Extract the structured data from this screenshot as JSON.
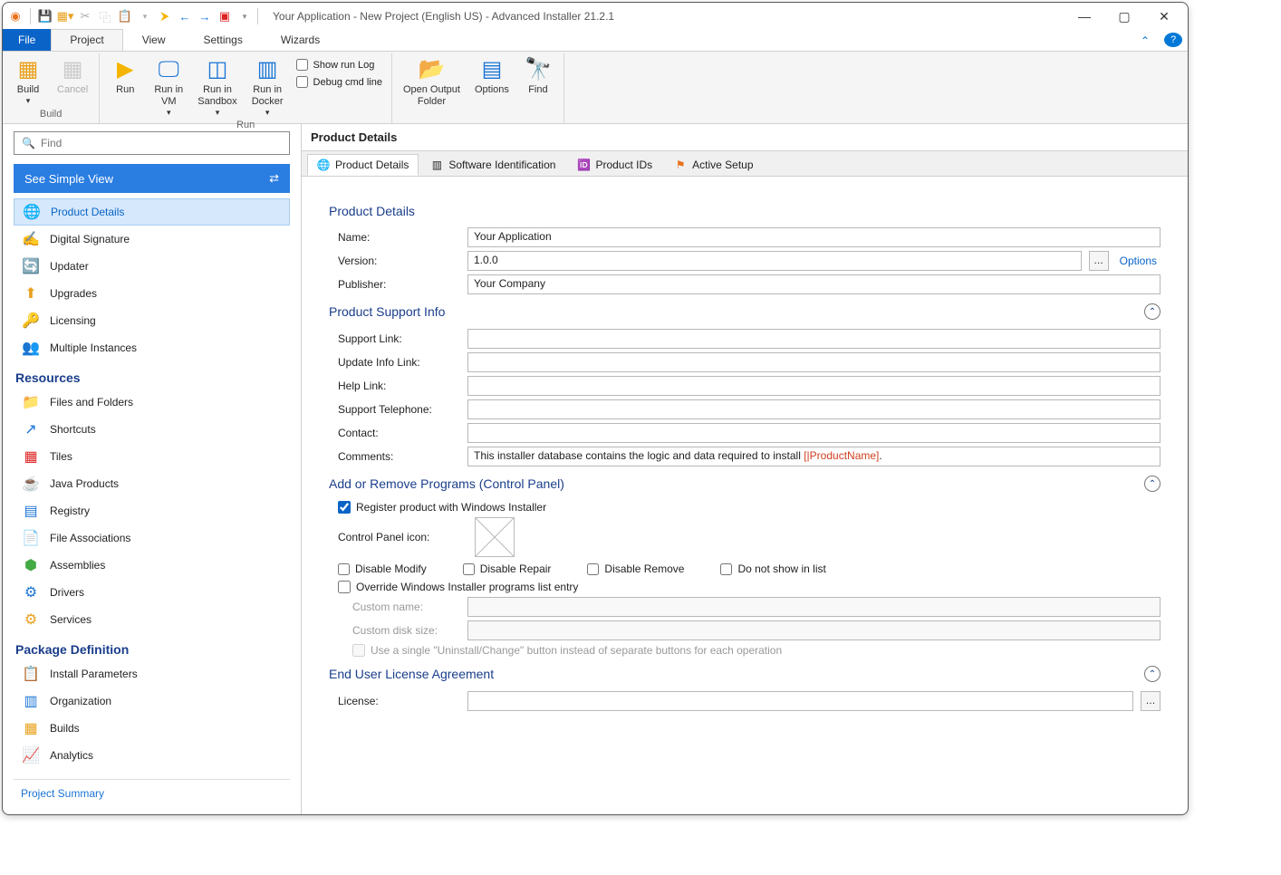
{
  "window": {
    "title": "Your Application - New Project (English US) - Advanced Installer 21.2.1"
  },
  "qat": {
    "icons": [
      "app-icon",
      "save-icon",
      "package-icon",
      "scissors-icon",
      "copy-icon",
      "paste-icon",
      "undo-icon",
      "forward-arrow-icon",
      "back-icon",
      "forward-icon",
      "ext-icon",
      "dropdown-icon"
    ]
  },
  "ribbon_tabs": {
    "file": "File",
    "items": [
      "Project",
      "View",
      "Settings",
      "Wizards"
    ]
  },
  "ribbon": {
    "build": {
      "build": "Build",
      "cancel": "Cancel",
      "label": "Build"
    },
    "run": {
      "run": "Run",
      "vm": "Run in\nVM",
      "sandbox": "Run in\nSandbox",
      "docker": "Run in\nDocker",
      "show_log": "Show run Log",
      "debug": "Debug cmd line",
      "open_output": "Open Output\nFolder",
      "options": "Options",
      "find": "Find",
      "label": "Run"
    }
  },
  "sidebar": {
    "search_placeholder": "Find",
    "simple_view": "See Simple View",
    "groups": [
      {
        "title": "",
        "items": [
          "Product Details",
          "Digital Signature",
          "Updater",
          "Upgrades",
          "Licensing",
          "Multiple Instances"
        ]
      },
      {
        "title": "Resources",
        "items": [
          "Files and Folders",
          "Shortcuts",
          "Tiles",
          "Java Products",
          "Registry",
          "File Associations",
          "Assemblies",
          "Drivers",
          "Services"
        ]
      },
      {
        "title": "Package Definition",
        "items": [
          "Install Parameters",
          "Organization",
          "Builds",
          "Analytics"
        ]
      }
    ],
    "footer": "Project Summary"
  },
  "tabs": {
    "header": "Product Details",
    "items": [
      "Product Details",
      "Software Identification",
      "Product IDs",
      "Active Setup"
    ]
  },
  "form": {
    "product_details": {
      "title": "Product Details",
      "name_lbl": "Name:",
      "name": "Your Application",
      "version_lbl": "Version:",
      "version": "1.0.0",
      "options": "Options",
      "publisher_lbl": "Publisher:",
      "publisher": "Your Company"
    },
    "support": {
      "title": "Product Support Info",
      "support_link": "Support Link:",
      "update_link": "Update Info Link:",
      "help_link": "Help Link:",
      "telephone": "Support Telephone:",
      "contact": "Contact:",
      "comments_lbl": "Comments:",
      "comments_pre": "This installer database contains the logic and data required to install ",
      "comments_token": "[|ProductName]",
      "comments_post": "."
    },
    "arp": {
      "title": "Add or Remove Programs (Control Panel)",
      "register": "Register product with Windows Installer",
      "cp_icon": "Control Panel icon:",
      "disable_modify": "Disable Modify",
      "disable_repair": "Disable Repair",
      "disable_remove": "Disable Remove",
      "no_show": "Do not show in list",
      "override": "Override Windows Installer programs list entry",
      "custom_name": "Custom name:",
      "custom_size": "Custom disk size:",
      "single": "Use a single \"Uninstall/Change\" button instead of separate buttons for each operation"
    },
    "eula": {
      "title": "End User License Agreement",
      "license": "License:"
    }
  }
}
